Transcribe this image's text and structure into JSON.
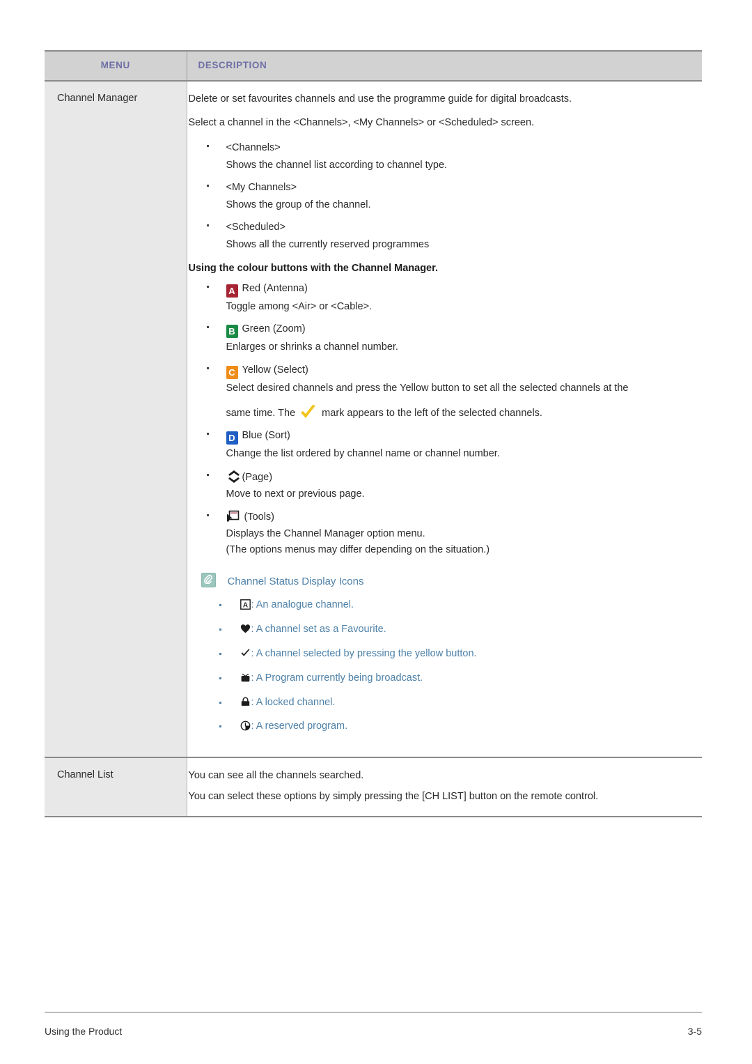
{
  "table": {
    "headers": {
      "menu": "MENU",
      "description": "DESCRIPTION"
    },
    "header_text_color": "#6f6fa6",
    "header_bg_color": "#d2d2d2",
    "menu_cell_bg_color": "#e8e8e8",
    "rows": [
      {
        "menu": "Channel Manager",
        "lead": [
          "Delete or set favourites channels and use the programme guide for digital broadcasts.",
          "Select a channel in the <Channels>, <My Channels> or <Scheduled> screen."
        ],
        "screen_bullets": [
          {
            "head": "<Channels>",
            "sub": "Shows the channel list according to channel type."
          },
          {
            "head": "<My Channels>",
            "sub": "Shows the group of the channel."
          },
          {
            "head": "<Scheduled>",
            "sub": "Shows all the currently reserved programmes"
          }
        ],
        "colour_heading": "Using the colour buttons with the Channel Manager.",
        "colour_bullets": [
          {
            "chip": "A",
            "chip_icon_name": "red-button-a-icon",
            "chip_color": "#a62433",
            "head": "Red (Antenna)",
            "sub": "Toggle among <Air> or <Cable>."
          },
          {
            "chip": "B",
            "chip_icon_name": "green-button-b-icon",
            "chip_color": "#1a8b45",
            "head": "Green (Zoom)",
            "sub": "Enlarges or shrinks a channel number."
          },
          {
            "chip": "C",
            "chip_icon_name": "yellow-button-c-icon",
            "chip_color": "#ef8d17",
            "head": "Yellow (Select)",
            "sub": "Select desired channels and press the Yellow button to set all the selected channels at the",
            "sub2_before": "same time. The",
            "sub2_icon_name": "yellow-check-mark-icon",
            "sub2_after": "mark appears to the left of the selected channels."
          },
          {
            "chip": "D",
            "chip_icon_name": "blue-button-d-icon",
            "chip_color": "#1f5fc4",
            "head": "Blue (Sort)",
            "sub": "Change the list ordered by channel name or channel number."
          }
        ],
        "nav_bullets": [
          {
            "icon_name": "page-updown-chevron-icon",
            "head": "(Page)",
            "sub": "Move to next or previous page.",
            "sub2": ""
          },
          {
            "icon_name": "tools-icon",
            "head": "(Tools)",
            "sub": "Displays the Channel Manager option menu.",
            "sub2": "(The options menus may differ depending on the situation.)"
          }
        ],
        "note": {
          "icon_name": "note-paperclip-icon",
          "icon_bg_color": "#9bc6bd",
          "text_color": "#4e81a8",
          "title": "Channel Status Display Icons",
          "items": [
            {
              "icon_name": "boxed-letter-a-icon",
              "text": ": An analogue channel."
            },
            {
              "icon_name": "heart-icon",
              "text": ": A channel set as a Favourite."
            },
            {
              "icon_name": "check-mark-icon",
              "text": ": A channel selected by pressing the yellow button."
            },
            {
              "icon_name": "tv-icon",
              "text": ": A Program currently being broadcast."
            },
            {
              "icon_name": "lock-icon",
              "text": ": A locked channel."
            },
            {
              "icon_name": "clock-icon",
              "text": ": A reserved program."
            }
          ]
        }
      },
      {
        "menu": "Channel List",
        "lines": [
          "You can see all the channels searched.",
          "You can select these options by simply pressing the [CH LIST] button on the remote control."
        ]
      }
    ]
  },
  "footer": {
    "left": "Using the Product",
    "right": "3-5"
  }
}
